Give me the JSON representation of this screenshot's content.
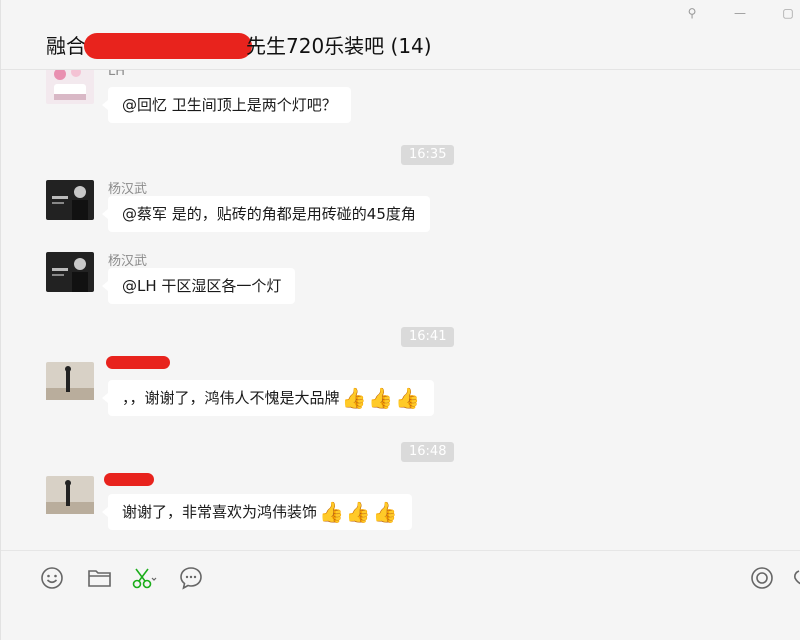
{
  "window": {
    "title_prefix": "融合",
    "title_suffix": "先生720乐装吧 (14)",
    "controls": {
      "pin": "⚲",
      "minimize": "—",
      "maximize": "▢"
    }
  },
  "messages": [
    {
      "sender": "LH",
      "text": "@回忆 卫生间顶上是两个灯吧？"
    },
    {
      "time": "16:35"
    },
    {
      "sender": "杨汉武",
      "text": "@蔡军 是的，贴砖的角都是用砖碰的45度角"
    },
    {
      "sender": "杨汉武",
      "text": "@LH 干区湿区各一个灯"
    },
    {
      "time": "16:41"
    },
    {
      "sender": "",
      "text": "，，谢谢了，鸿伟人不愧是大品牌",
      "thumbs": 3
    },
    {
      "time": "16:48"
    },
    {
      "sender": "",
      "text": "谢谢了，非常喜欢为鸿伟装饰",
      "thumbs": 3
    }
  ],
  "emoji": {
    "thumbs_up": "👍"
  },
  "colors": {
    "redaction": "#e8231d",
    "bubble": "#ffffff",
    "background": "#f5f5f5",
    "timestamp_bg": "#dadada"
  },
  "toolbar": {
    "icons": [
      "emoji-icon",
      "folder-icon",
      "scissors-icon",
      "chat-history-icon",
      "voice-call-icon"
    ]
  }
}
